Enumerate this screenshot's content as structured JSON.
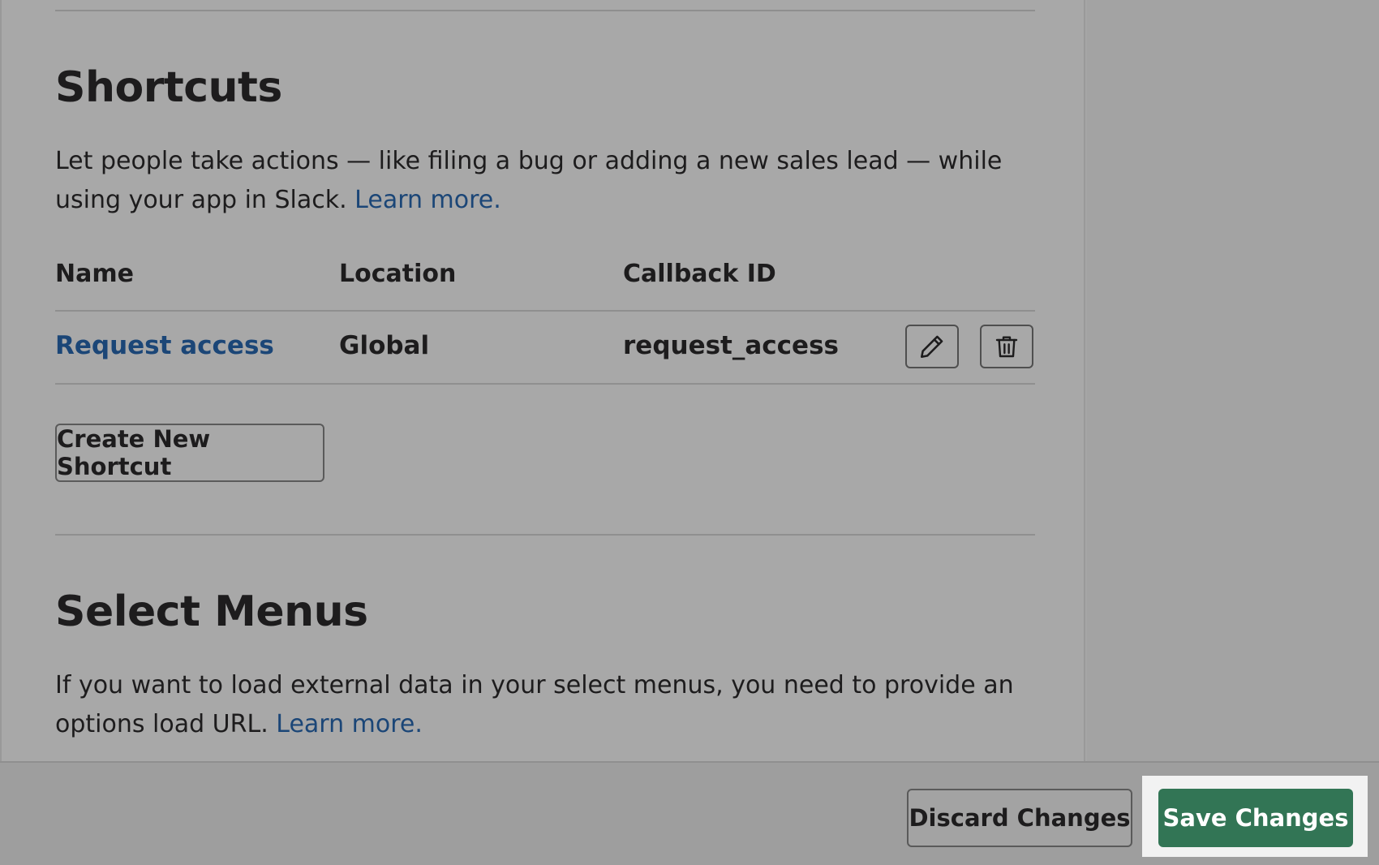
{
  "shortcuts": {
    "title": "Shortcuts",
    "description": "Let people take actions — like filing a bug or adding a new sales lead — while using your app in Slack.",
    "learn_more": "Learn more.",
    "table": {
      "headers": {
        "name": "Name",
        "location": "Location",
        "callback_id": "Callback ID"
      },
      "rows": [
        {
          "name": "Request access",
          "location": "Global",
          "callback_id": "request_access"
        }
      ]
    },
    "create_button": "Create New Shortcut",
    "icons": {
      "edit": "pencil-icon",
      "delete": "trash-icon"
    }
  },
  "select_menus": {
    "title": "Select Menus",
    "description": "If you want to load external data in your select menus, you need to provide an options load URL.",
    "learn_more": "Learn more."
  },
  "footer": {
    "discard_label": "Discard Changes",
    "save_label": "Save Changes"
  },
  "colors": {
    "link": "#1b4677",
    "save_button": "#327555",
    "overlay_bg": "#a8a8a8"
  }
}
